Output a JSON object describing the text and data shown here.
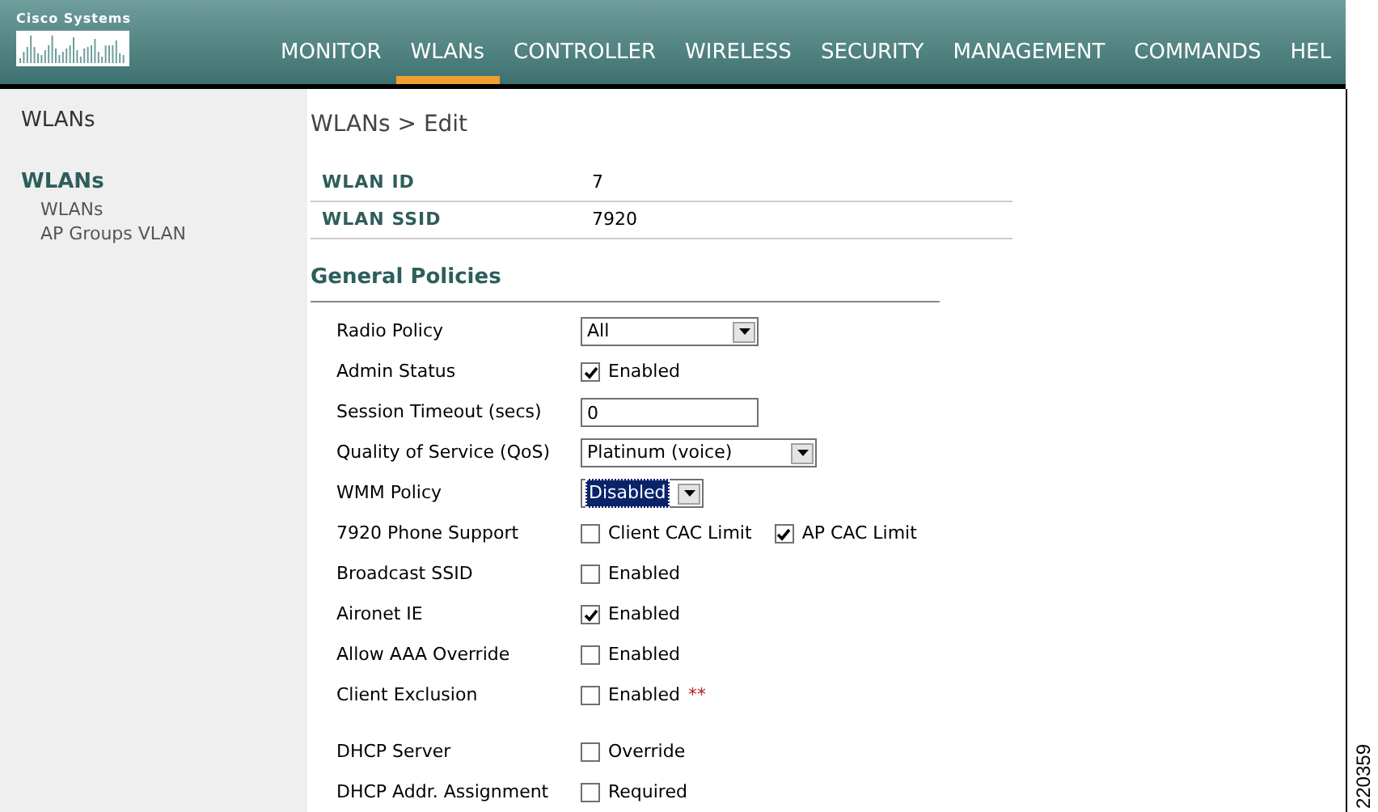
{
  "header": {
    "logo_text": "Cisco Systems",
    "nav": [
      {
        "label": "MONITOR",
        "selected": false
      },
      {
        "label": "WLANs",
        "selected": true
      },
      {
        "label": "CONTROLLER",
        "selected": false
      },
      {
        "label": "WIRELESS",
        "selected": false
      },
      {
        "label": "SECURITY",
        "selected": false
      },
      {
        "label": "MANAGEMENT",
        "selected": false
      },
      {
        "label": "COMMANDS",
        "selected": false
      },
      {
        "label": "HEL",
        "selected": false
      }
    ]
  },
  "sidebar": {
    "title": "WLANs",
    "section": "WLANs",
    "items": [
      "WLANs",
      "AP Groups VLAN"
    ]
  },
  "main": {
    "breadcrumb": "WLANs > Edit",
    "info": [
      {
        "label": "WLAN ID",
        "value": "7"
      },
      {
        "label": "WLAN SSID",
        "value": "7920"
      }
    ],
    "section_title": "General Policies",
    "policy_groups": [
      [
        {
          "label": "Radio Policy",
          "kind": "select",
          "value": "All",
          "focused": false
        },
        {
          "label": "Admin Status",
          "kind": "checkbox",
          "options": [
            {
              "label": "Enabled",
              "checked": true
            }
          ]
        },
        {
          "label": "Session Timeout (secs)",
          "kind": "input",
          "value": "0"
        },
        {
          "label": "Quality of Service (QoS)",
          "kind": "select",
          "value": "Platinum (voice)",
          "focused": false
        },
        {
          "label": "WMM Policy",
          "kind": "select",
          "value": "Disabled",
          "focused": true
        },
        {
          "label": "7920 Phone Support",
          "kind": "checkbox",
          "options": [
            {
              "label": "Client CAC Limit",
              "checked": false
            },
            {
              "label": "AP CAC Limit",
              "checked": true
            }
          ]
        },
        {
          "label": "Broadcast SSID",
          "kind": "checkbox",
          "options": [
            {
              "label": "Enabled",
              "checked": false
            }
          ]
        },
        {
          "label": "Aironet IE",
          "kind": "checkbox",
          "options": [
            {
              "label": "Enabled",
              "checked": true
            }
          ]
        },
        {
          "label": "Allow AAA Override",
          "kind": "checkbox",
          "options": [
            {
              "label": "Enabled",
              "checked": false
            }
          ]
        },
        {
          "label": "Client Exclusion",
          "kind": "checkbox",
          "options": [
            {
              "label": "Enabled",
              "checked": false,
              "note": "**"
            }
          ]
        }
      ],
      [
        {
          "label": "DHCP Server",
          "kind": "checkbox",
          "options": [
            {
              "label": "Override",
              "checked": false
            }
          ]
        },
        {
          "label": "DHCP Addr. Assignment",
          "kind": "checkbox",
          "options": [
            {
              "label": "Required",
              "checked": false
            }
          ]
        }
      ]
    ]
  },
  "figure_number": "220359"
}
